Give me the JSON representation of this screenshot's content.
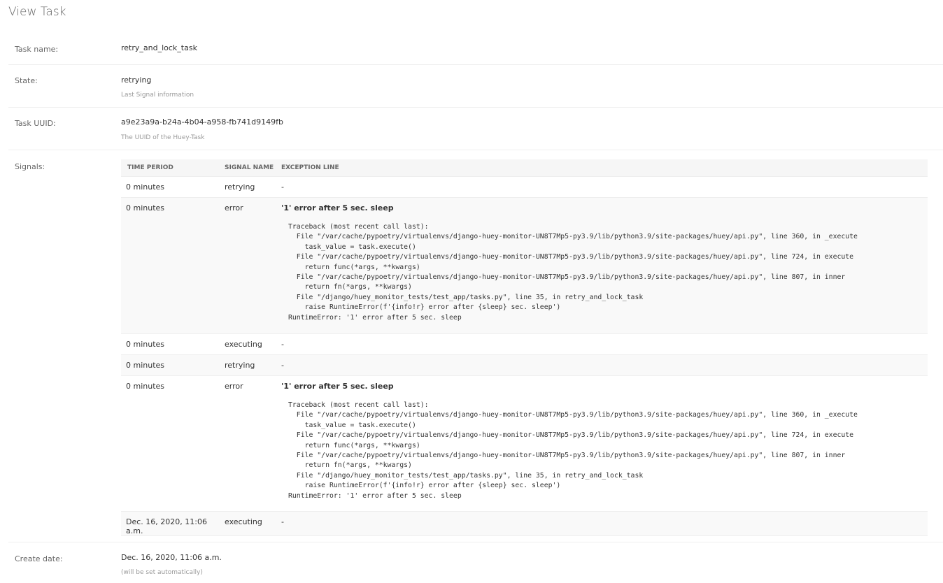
{
  "page": {
    "title": "View Task"
  },
  "fields": {
    "task_name": {
      "label": "Task name:",
      "value": "retry_and_lock_task"
    },
    "state": {
      "label": "State:",
      "value": "retrying",
      "help": "Last Signal information"
    },
    "uuid": {
      "label": "Task UUID:",
      "value": "a9e23a9a-b24a-4b04-a958-fb741d9149fb",
      "help": "The UUID of the Huey-Task"
    },
    "signals": {
      "label": "Signals:"
    },
    "create_date": {
      "label": "Create date:",
      "value": "Dec. 16, 2020, 11:06 a.m.",
      "help": "(will be set automatically)"
    }
  },
  "signals_table": {
    "headers": [
      "TIME PERIOD",
      "SIGNAL NAME",
      "EXCEPTION LINE"
    ],
    "rows": [
      {
        "time": "0 minutes",
        "signal": "retrying",
        "exception": "-"
      },
      {
        "time": "0 minutes",
        "signal": "error",
        "exception": "'1' error after 5 sec. sleep",
        "traceback": "Traceback (most recent call last):\n  File \"/var/cache/pypoetry/virtualenvs/django-huey-monitor-UN8T7Mp5-py3.9/lib/python3.9/site-packages/huey/api.py\", line 360, in _execute\n    task_value = task.execute()\n  File \"/var/cache/pypoetry/virtualenvs/django-huey-monitor-UN8T7Mp5-py3.9/lib/python3.9/site-packages/huey/api.py\", line 724, in execute\n    return func(*args, **kwargs)\n  File \"/var/cache/pypoetry/virtualenvs/django-huey-monitor-UN8T7Mp5-py3.9/lib/python3.9/site-packages/huey/api.py\", line 807, in inner\n    return fn(*args, **kwargs)\n  File \"/django/huey_monitor_tests/test_app/tasks.py\", line 35, in retry_and_lock_task\n    raise RuntimeError(f'{info!r} error after {sleep} sec. sleep')\nRuntimeError: '1' error after 5 sec. sleep"
      },
      {
        "time": "0 minutes",
        "signal": "executing",
        "exception": "-"
      },
      {
        "time": "0 minutes",
        "signal": "retrying",
        "exception": "-"
      },
      {
        "time": "0 minutes",
        "signal": "error",
        "exception": "'1' error after 5 sec. sleep",
        "traceback": "Traceback (most recent call last):\n  File \"/var/cache/pypoetry/virtualenvs/django-huey-monitor-UN8T7Mp5-py3.9/lib/python3.9/site-packages/huey/api.py\", line 360, in _execute\n    task_value = task.execute()\n  File \"/var/cache/pypoetry/virtualenvs/django-huey-monitor-UN8T7Mp5-py3.9/lib/python3.9/site-packages/huey/api.py\", line 724, in execute\n    return func(*args, **kwargs)\n  File \"/var/cache/pypoetry/virtualenvs/django-huey-monitor-UN8T7Mp5-py3.9/lib/python3.9/site-packages/huey/api.py\", line 807, in inner\n    return fn(*args, **kwargs)\n  File \"/django/huey_monitor_tests/test_app/tasks.py\", line 35, in retry_and_lock_task\n    raise RuntimeError(f'{info!r} error after {sleep} sec. sleep')\nRuntimeError: '1' error after 5 sec. sleep"
      },
      {
        "time": "Dec. 16, 2020, 11:06 a.m.",
        "signal": "executing",
        "exception": "-"
      }
    ]
  }
}
